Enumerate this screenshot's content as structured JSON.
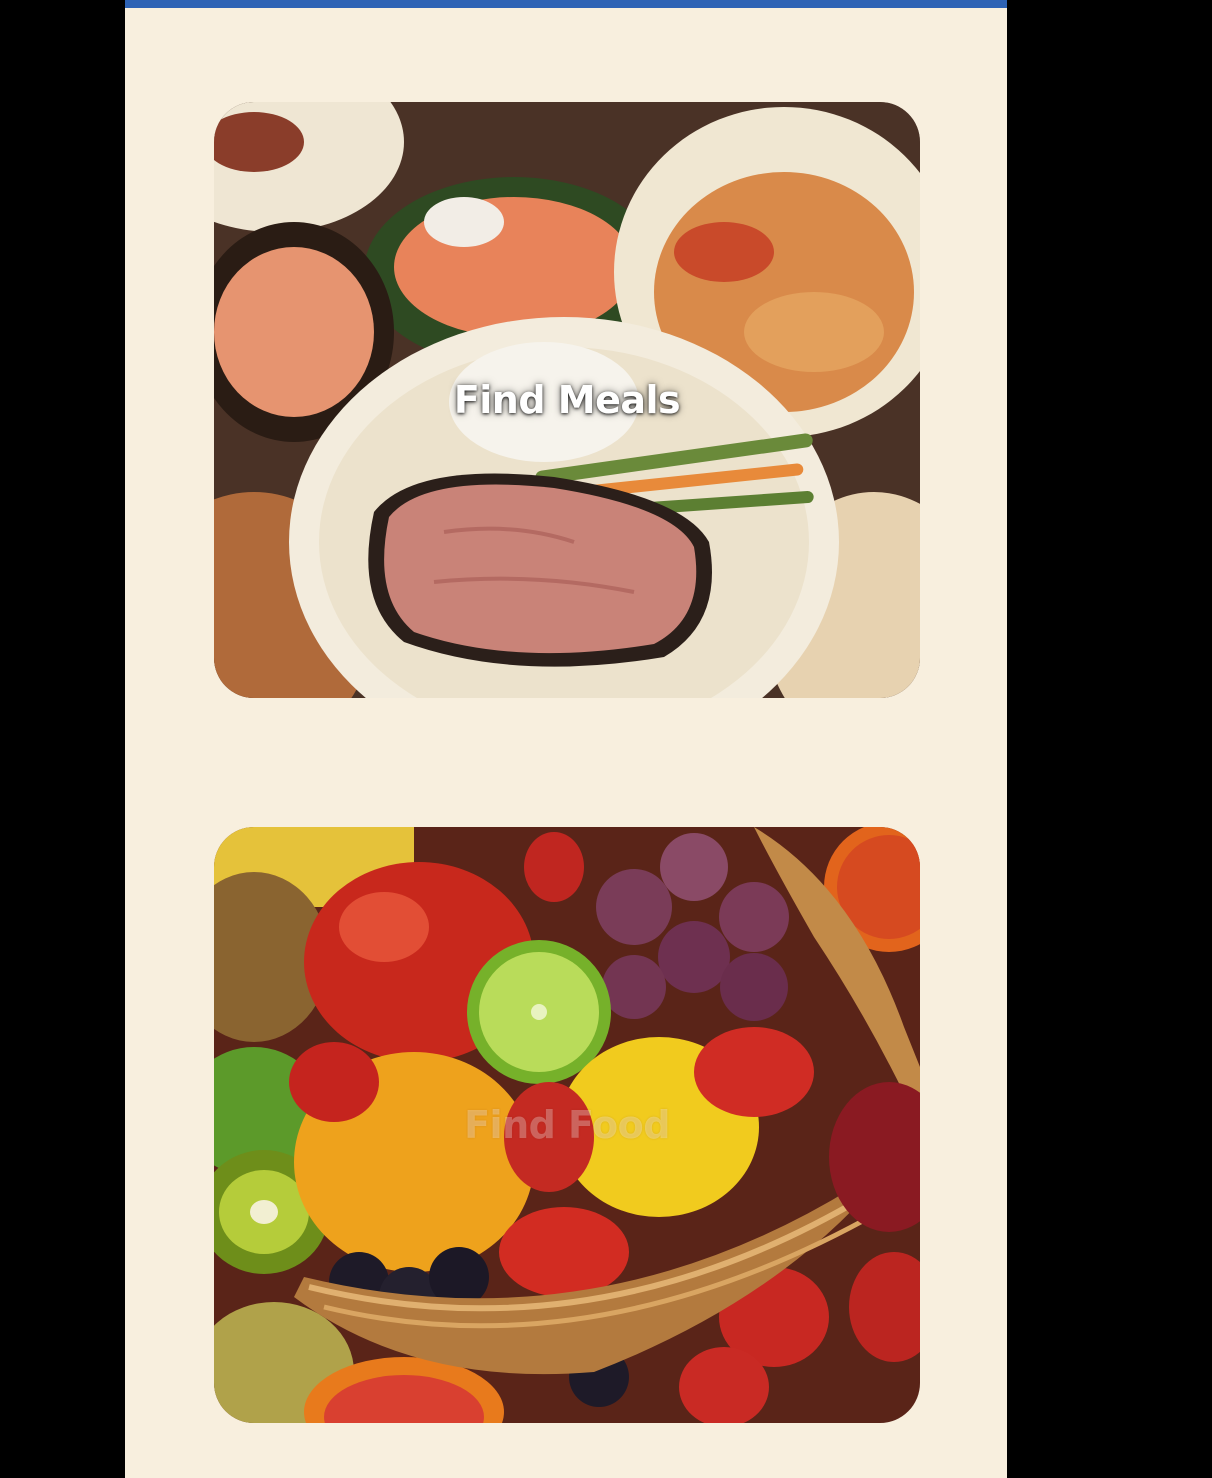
{
  "app": {
    "accent_bar_color": "#2e63b5",
    "background_color": "#f8efde"
  },
  "cards": [
    {
      "label": "Find Meals",
      "image": "plated-meals-photo"
    },
    {
      "label": "Find Food",
      "image": "fruit-basket-photo"
    }
  ]
}
